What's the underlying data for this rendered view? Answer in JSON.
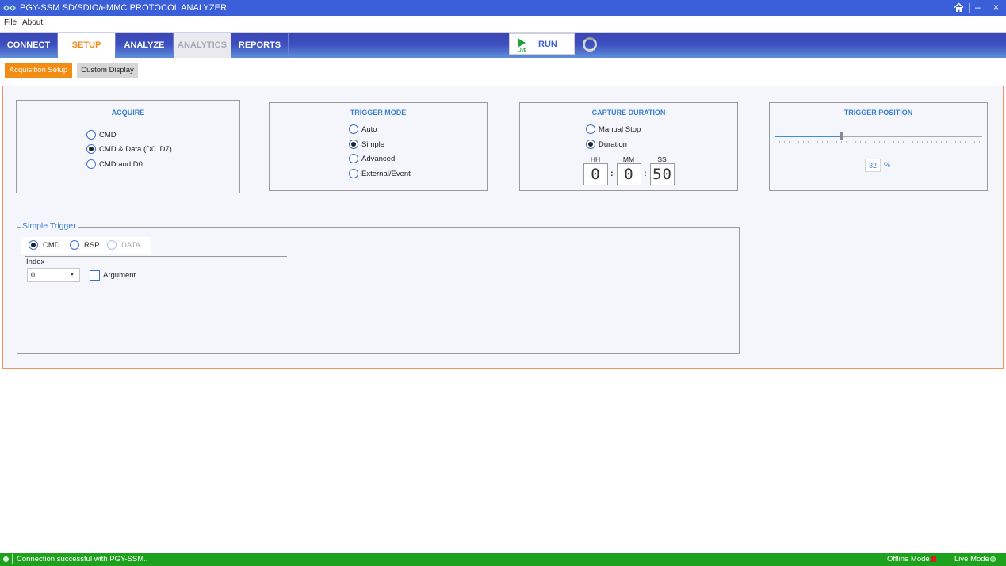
{
  "window": {
    "title": "PGY-SSM SD/SDIO/eMMC PROTOCOL ANALYZER",
    "home_icon": "home-icon",
    "minimize_glyph": "–",
    "close_glyph": "×"
  },
  "menu": {
    "file": "File",
    "about": "About"
  },
  "nav": {
    "tabs": [
      {
        "label": "CONNECT",
        "state": "normal"
      },
      {
        "label": "SETUP",
        "state": "active"
      },
      {
        "label": "ANALYZE",
        "state": "normal"
      },
      {
        "label": "ANALYTICS",
        "state": "disabled"
      },
      {
        "label": "REPORTS",
        "state": "normal"
      }
    ],
    "run": {
      "label": "RUN",
      "badge": "LIVE"
    }
  },
  "subtabs": {
    "acquisition": "Acquisition Setup",
    "custom": "Custom Display"
  },
  "acquire": {
    "title": "ACQUIRE",
    "options": [
      {
        "label": "CMD",
        "selected": false
      },
      {
        "label": "CMD & Data (D0..D7)",
        "selected": true
      },
      {
        "label": "CMD and D0",
        "selected": false
      }
    ]
  },
  "trigger_mode": {
    "title": "TRIGGER MODE",
    "options": [
      {
        "label": "Auto",
        "selected": false
      },
      {
        "label": "Simple",
        "selected": true
      },
      {
        "label": "Advanced",
        "selected": false
      },
      {
        "label": "External/Event",
        "selected": false
      }
    ]
  },
  "capture_duration": {
    "title": "CAPTURE DURATION",
    "options": [
      {
        "label": "Manual Stop",
        "selected": false
      },
      {
        "label": "Duration",
        "selected": true
      }
    ],
    "hh_label": "HH",
    "mm_label": "MM",
    "ss_label": "SS",
    "hh": "0",
    "mm": "0",
    "ss": "50",
    "separator": ":"
  },
  "trigger_position": {
    "title": "TRIGGER POSITION",
    "value": "32",
    "unit": "%",
    "level_percent": 32
  },
  "simple_trigger": {
    "title": "Simple Trigger",
    "options": [
      {
        "label": "CMD",
        "selected": true,
        "enabled": true
      },
      {
        "label": "RSP",
        "selected": false,
        "enabled": true
      },
      {
        "label": "DATA",
        "selected": false,
        "enabled": false
      }
    ],
    "index_label": "Index",
    "index_value": "0",
    "argument_label": "Argument",
    "argument_checked": false
  },
  "status": {
    "message": "Connection successful with PGY-SSM..",
    "offline_mode": "Offline Mode",
    "live_mode": "Live Mode",
    "colors": {
      "bar": "#1ea21e",
      "offline_indicator": "#d81e1e",
      "live_indicator": "#5fd25f"
    }
  },
  "colors": {
    "accent": "#f28c12",
    "primary": "#3b5fd9",
    "heading": "#3b7fd3"
  }
}
